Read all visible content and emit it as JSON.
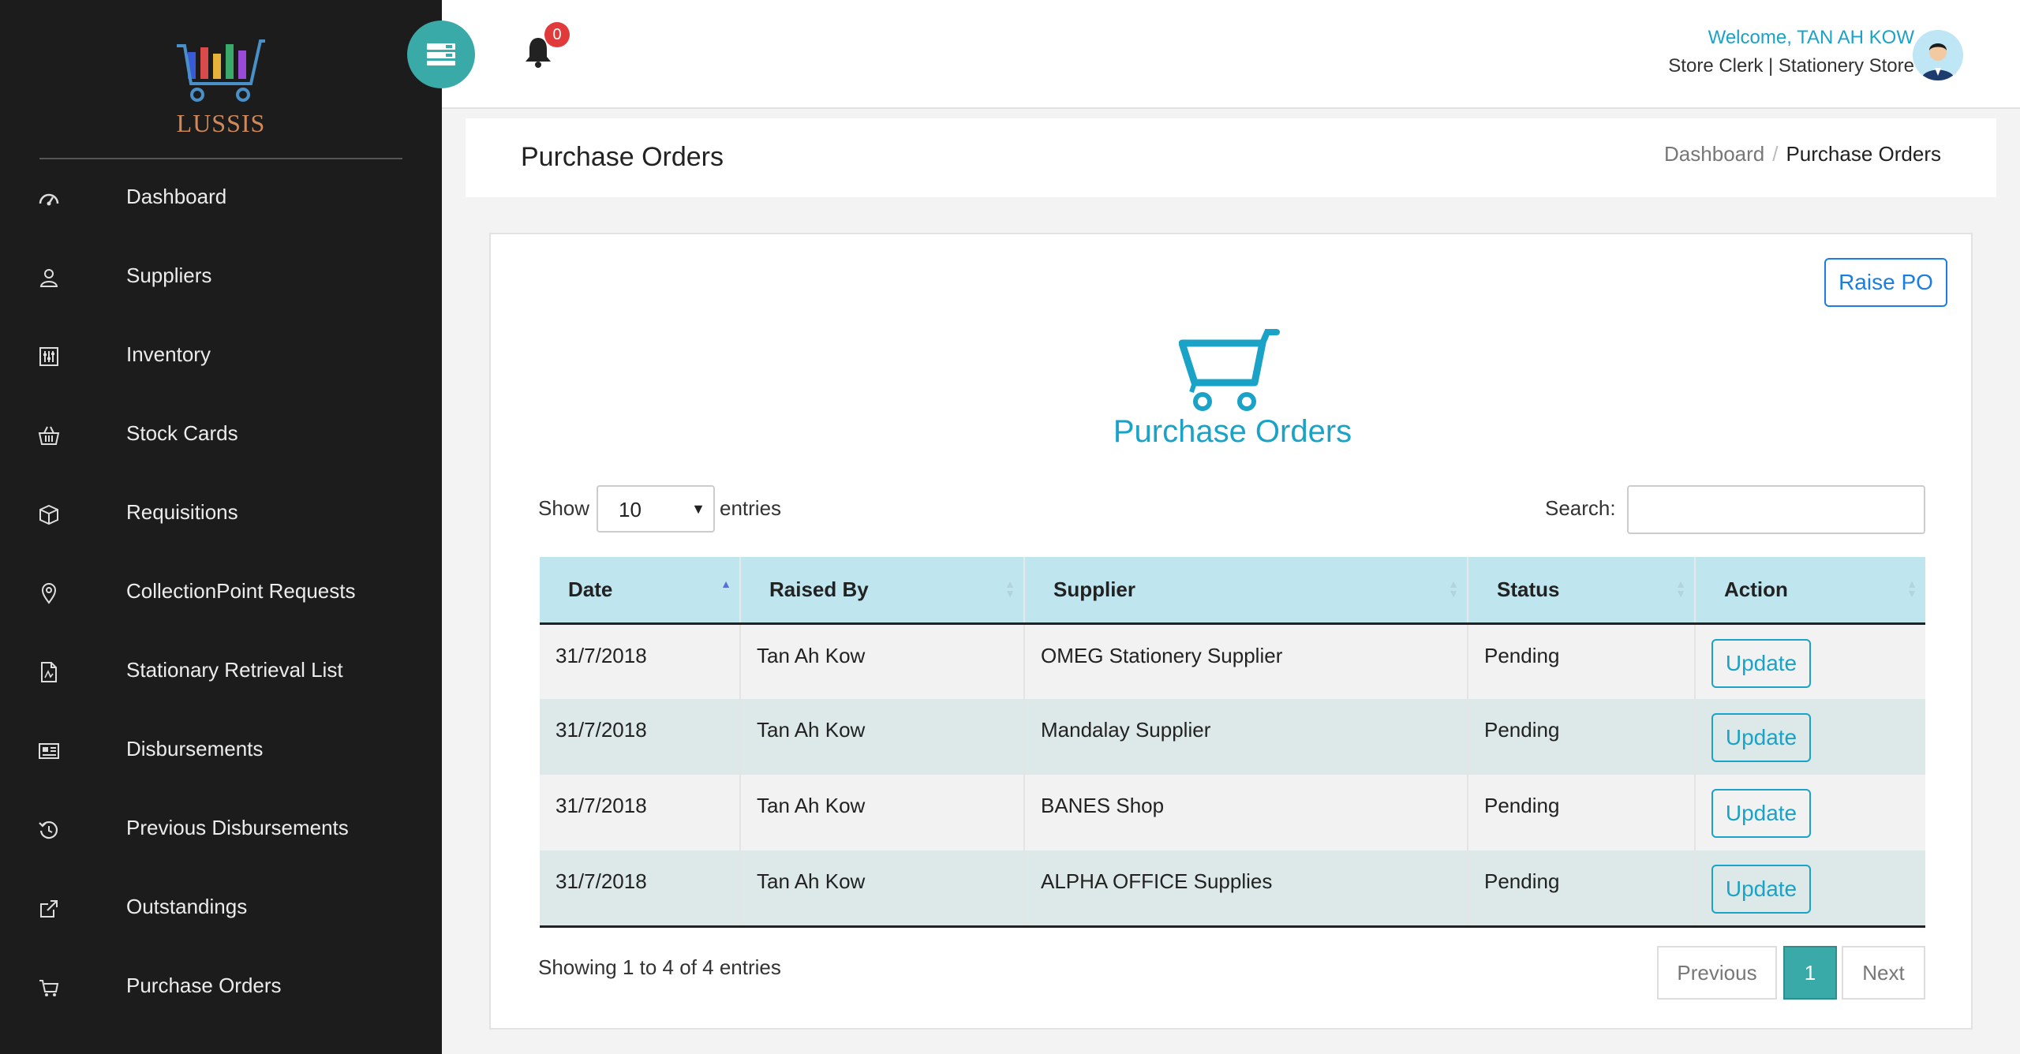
{
  "brand": {
    "name": "LUSSIS"
  },
  "sidebar": {
    "items": [
      {
        "label": "Dashboard",
        "icon": "dashboard-gauge-icon"
      },
      {
        "label": "Suppliers",
        "icon": "user-icon"
      },
      {
        "label": "Inventory",
        "icon": "sliders-icon"
      },
      {
        "label": "Stock Cards",
        "icon": "basket-icon"
      },
      {
        "label": "Requisitions",
        "icon": "box-icon"
      },
      {
        "label": "CollectionPoint Requests",
        "icon": "map-pin-icon"
      },
      {
        "label": "Stationary Retrieval List",
        "icon": "pdf-file-icon"
      },
      {
        "label": "Disbursements",
        "icon": "newspaper-icon"
      },
      {
        "label": "Previous Disbursements",
        "icon": "history-icon"
      },
      {
        "label": "Outstandings",
        "icon": "external-link-icon"
      },
      {
        "label": "Purchase Orders",
        "icon": "cart-icon"
      }
    ]
  },
  "header": {
    "notification_count": "0",
    "welcome": "Welcome, TAN AH KOW",
    "role": "Store Clerk | Stationery Store"
  },
  "page": {
    "title": "Purchase Orders",
    "breadcrumb": {
      "home": "Dashboard",
      "current": "Purchase Orders"
    }
  },
  "card": {
    "raise_button": "Raise PO",
    "heading": "Purchase Orders",
    "show_label": "Show",
    "page_size": "10",
    "entries_label": "entries",
    "search_label": "Search:",
    "search_value": ""
  },
  "table": {
    "columns": [
      "Date",
      "Raised By",
      "Supplier",
      "Status",
      "Action"
    ],
    "rows": [
      {
        "date": "31/7/2018",
        "raised_by": "Tan Ah Kow",
        "supplier": "OMEG Stationery Supplier",
        "status": "Pending",
        "action": "Update"
      },
      {
        "date": "31/7/2018",
        "raised_by": "Tan Ah Kow",
        "supplier": "Mandalay Supplier",
        "status": "Pending",
        "action": "Update"
      },
      {
        "date": "31/7/2018",
        "raised_by": "Tan Ah Kow",
        "supplier": "BANES Shop",
        "status": "Pending",
        "action": "Update"
      },
      {
        "date": "31/7/2018",
        "raised_by": "Tan Ah Kow",
        "supplier": "ALPHA OFFICE Supplies",
        "status": "Pending",
        "action": "Update"
      }
    ]
  },
  "footer": {
    "showing": "Showing 1 to 4 of 4 entries",
    "previous": "Previous",
    "current_page": "1",
    "next": "Next"
  },
  "colors": {
    "sidebar_bg": "#1c1c1c",
    "accent_teal": "#3aaaa8",
    "accent_cyan": "#1aa3c7",
    "link_blue": "#1a7ee0",
    "badge_red": "#e03a3a",
    "header_row_bg": "#bfe6ef"
  }
}
